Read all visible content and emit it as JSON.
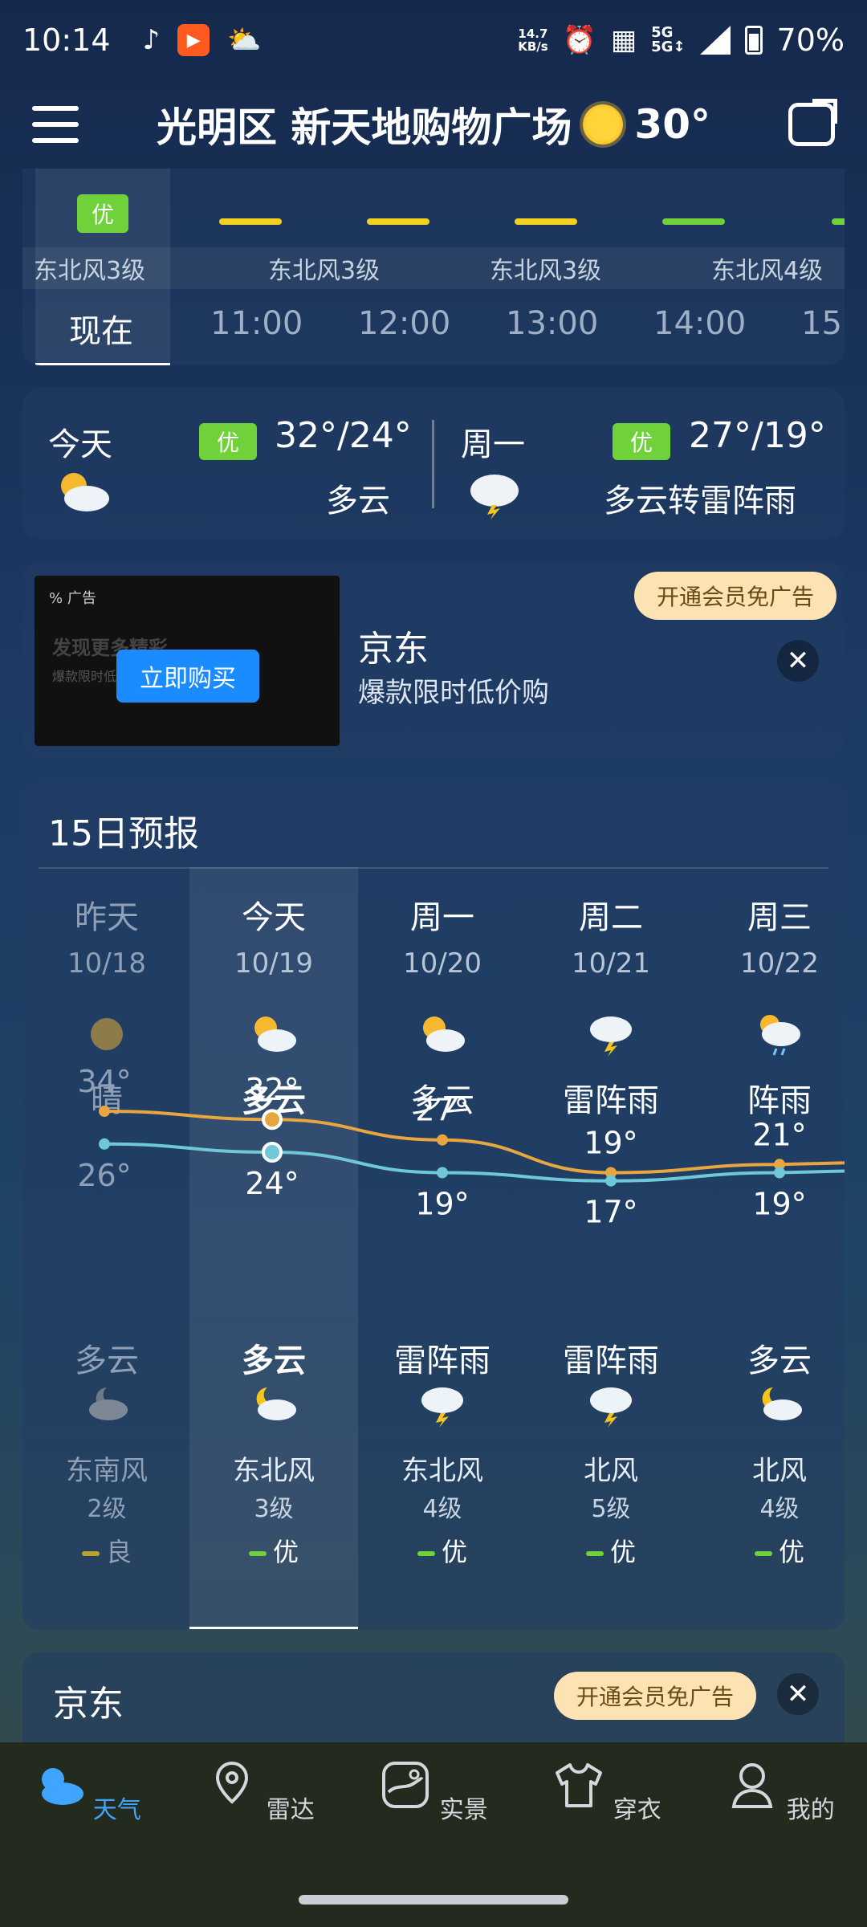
{
  "status": {
    "time": "10:14",
    "net_speed": "14.7",
    "net_unit": "KB/s",
    "signal1": "5G",
    "signal2": "5G↕",
    "battery": "70%"
  },
  "header": {
    "location": "光明区 新天地购物广场",
    "temp": "30°"
  },
  "hourly": {
    "items": [
      {
        "time": "现在",
        "wind": "东北风3级",
        "aqi": "优",
        "bar_color": ""
      },
      {
        "time": "11:00",
        "wind": "",
        "aqi": "",
        "bar_color": "#f2d21f"
      },
      {
        "time": "12:00",
        "wind": "东北风3级",
        "aqi": "",
        "bar_color": "#f2d21f"
      },
      {
        "time": "13:00",
        "wind": "东北风3级",
        "aqi": "",
        "bar_color": "#f2d21f"
      },
      {
        "time": "14:00",
        "wind": "",
        "aqi": "",
        "bar_color": "#6fd23a"
      },
      {
        "time": "15:",
        "wind": "东北风4级",
        "aqi": "",
        "bar_color": "#6fd23a"
      }
    ]
  },
  "today": {
    "label": "今天",
    "aqi": "优",
    "range": "32°/24°",
    "cond": "多云"
  },
  "tomorrow": {
    "label": "周一",
    "aqi": "优",
    "range": "27°/19°",
    "cond": "多云转雷阵雨"
  },
  "ad": {
    "tag": "广告",
    "ghost1": "发现更多精彩",
    "ghost2": "爆款限时低价",
    "button": "立即购买",
    "title": "京东",
    "subtitle": "爆款限时低价购",
    "vip": "开通会员免广告"
  },
  "forecast": {
    "title": "15日预报",
    "days": [
      {
        "name": "昨天",
        "date": "10/18",
        "day_cond": "晴",
        "night_cond": "多云",
        "wind": "东南风",
        "level": "2级",
        "aqi": "良",
        "aqi_color": "#b8a531",
        "high": "34°",
        "low": "26°"
      },
      {
        "name": "今天",
        "date": "10/19",
        "day_cond": "多云",
        "night_cond": "多云",
        "wind": "东北风",
        "level": "3级",
        "aqi": "优",
        "aqi_color": "#6fd23a",
        "high": "32°",
        "low": "24°"
      },
      {
        "name": "周一",
        "date": "10/20",
        "day_cond": "多云",
        "night_cond": "雷阵雨",
        "wind": "东北风",
        "level": "4级",
        "aqi": "优",
        "aqi_color": "#6fd23a",
        "high": "27°",
        "low": "19°"
      },
      {
        "name": "周二",
        "date": "10/21",
        "day_cond": "雷阵雨",
        "night_cond": "雷阵雨",
        "wind": "北风",
        "level": "5级",
        "aqi": "优",
        "aqi_color": "#6fd23a",
        "high": "19°",
        "low": "17°"
      },
      {
        "name": "周三",
        "date": "10/22",
        "day_cond": "阵雨",
        "night_cond": "多云",
        "wind": "北风",
        "level": "4级",
        "aqi": "优",
        "aqi_color": "#6fd23a",
        "high": "21°",
        "low": "19°"
      }
    ]
  },
  "ad2": {
    "title": "京东",
    "vip": "开通会员免广告"
  },
  "nav": {
    "items": [
      {
        "label": "天气",
        "icon": "weather-icon",
        "active": true
      },
      {
        "label": "雷达",
        "icon": "location-pin-icon",
        "active": false
      },
      {
        "label": "实景",
        "icon": "photo-icon",
        "active": false
      },
      {
        "label": "穿衣",
        "icon": "shirt-icon",
        "active": false
      },
      {
        "label": "我的",
        "icon": "user-icon",
        "active": false
      }
    ]
  },
  "colors": {
    "accent": "#3fa5ff",
    "aqi_good": "#6fd23a",
    "high_line": "#e8a640",
    "low_line": "#6ec8d8"
  }
}
